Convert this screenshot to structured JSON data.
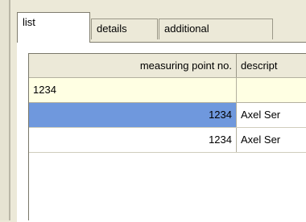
{
  "tabs": [
    {
      "label": "list"
    },
    {
      "label": "details"
    },
    {
      "label": "additional"
    }
  ],
  "grid": {
    "columns": [
      {
        "label": "measuring point no."
      },
      {
        "label": "descript"
      }
    ],
    "filter": {
      "measuring_point_no": "1234",
      "description": ""
    },
    "rows": [
      {
        "measuring_point_no": "1234",
        "description": "Axel Ser",
        "selected": true
      },
      {
        "measuring_point_no": "1234",
        "description": "Axel Ser",
        "selected": false
      }
    ]
  },
  "colors": {
    "background": "#ece9d8",
    "selection": "#6f98dd",
    "filter_row": "#ffffe3"
  }
}
